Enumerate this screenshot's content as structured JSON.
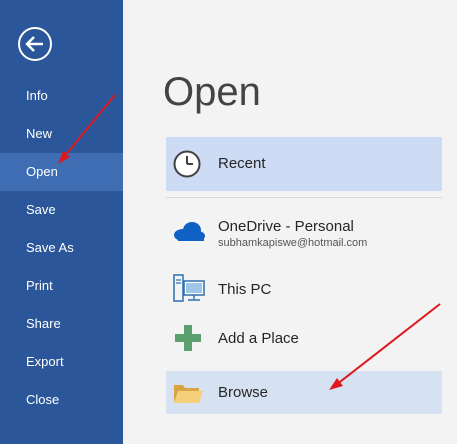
{
  "sidebar": {
    "back_icon": "back-arrow-circle-icon",
    "items": [
      {
        "label": "Info"
      },
      {
        "label": "New"
      },
      {
        "label": "Open",
        "active": true
      },
      {
        "label": "Save"
      },
      {
        "label": "Save As"
      },
      {
        "label": "Print"
      },
      {
        "label": "Share"
      },
      {
        "label": "Export"
      },
      {
        "label": "Close"
      }
    ]
  },
  "main": {
    "title": "Open",
    "locations": [
      {
        "label": "Recent",
        "icon": "clock-icon",
        "state": "selected"
      },
      {
        "label": "OneDrive - Personal",
        "sublabel": "subhamkapiswe@hotmail.com",
        "icon": "onedrive-cloud-icon"
      },
      {
        "label": "This PC",
        "icon": "computer-icon"
      },
      {
        "label": "Add a Place",
        "icon": "plus-icon"
      },
      {
        "label": "Browse",
        "icon": "folder-icon",
        "state": "hover"
      }
    ]
  },
  "colors": {
    "sidebar": "#2b579a",
    "sidebar_active": "#3e6db3",
    "selected": "#cddcf4",
    "annotation_arrow": "#e0191f"
  }
}
